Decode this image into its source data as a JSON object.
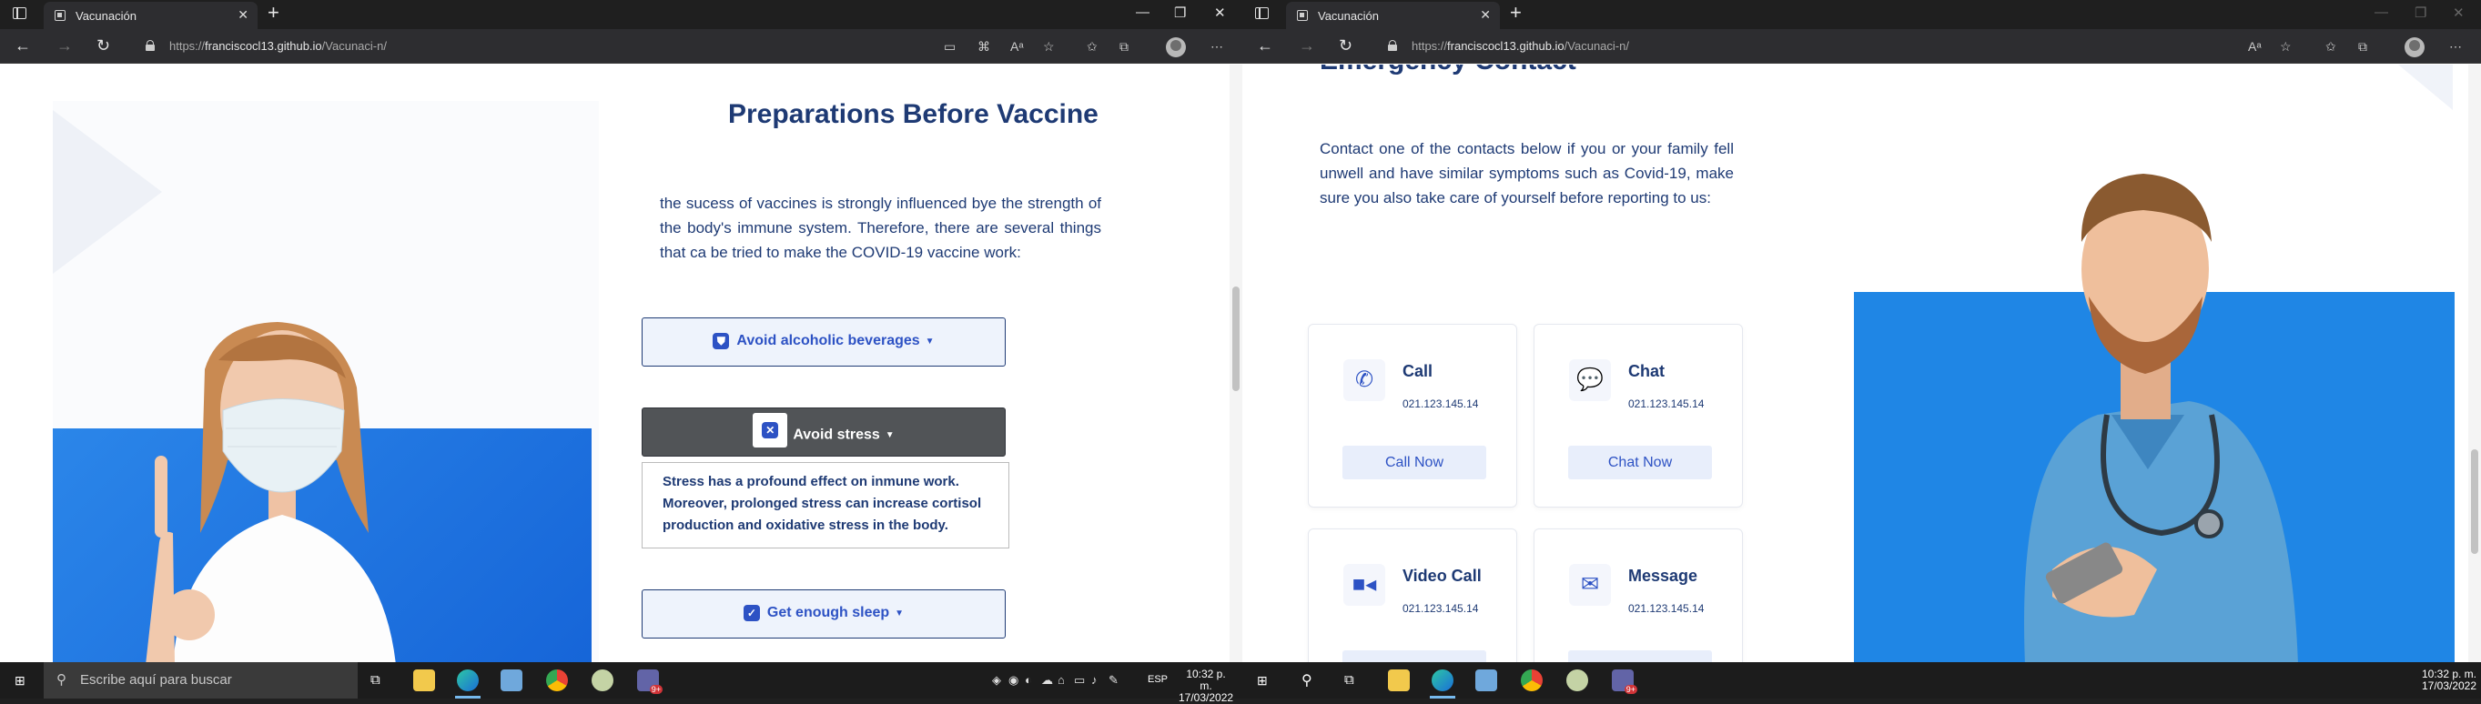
{
  "left_window": {
    "tab_title": "Vacunación",
    "url_prefix": "https://",
    "url_host": "franciscocl13.github.io",
    "url_path": "/Vacunaci-n/",
    "page": {
      "heading": "Preparations Before Vaccine",
      "intro": "the sucess of vaccines is strongly influenced bye the strength of the body's immune system. Therefore, there are several things that ca be tried to make the COVID-19 vaccine work:",
      "accordion": [
        {
          "label": "Avoid alcoholic beverages",
          "expanded": false
        },
        {
          "label": "Avoid stress",
          "expanded": true,
          "body": "Stress has a profound effect on inmune work. Moreover, prolonged stress can increase cortisol production and oxidative stress in the body."
        },
        {
          "label": "Get enough sleep",
          "expanded": false
        }
      ]
    },
    "scroll_position": 0.45
  },
  "right_window": {
    "tab_title": "Vacunación",
    "url_prefix": "https://",
    "url_host": "franciscocl13.github.io",
    "url_path": "/Vacunaci-n/",
    "page": {
      "heading": "Emergency Contact",
      "intro": "Contact one of the contacts below if you or your family fell unwell and have similar symptoms such as Covid-19, make sure you also take care of yourself before reporting to us:",
      "contacts": [
        {
          "title": "Call",
          "number": "021.123.145.14",
          "button": "Call Now",
          "icon": "phone-icon"
        },
        {
          "title": "Chat",
          "number": "021.123.145.14",
          "button": "Chat Now",
          "icon": "chat-bubble-icon"
        },
        {
          "title": "Video Call",
          "number": "021.123.145.14",
          "button": "",
          "icon": "video-camera-icon"
        },
        {
          "title": "Message",
          "number": "021.123.145.14",
          "button": "",
          "icon": "envelope-icon"
        }
      ]
    },
    "scroll_position": 0.78
  },
  "taskbar": {
    "search_placeholder": "Escribe aquí para buscar",
    "language": "ESP",
    "left_time": "10:32 p. m.",
    "left_date": "17/03/2022",
    "right_time": "10:32 p. m.",
    "right_date": "17/03/2022",
    "teams_badge": "9+"
  },
  "colors": {
    "heading": "#1e3a74",
    "accent": "#2d52c4",
    "accordion_active": "#515457",
    "photo_ribbon": "#1f78e0"
  }
}
